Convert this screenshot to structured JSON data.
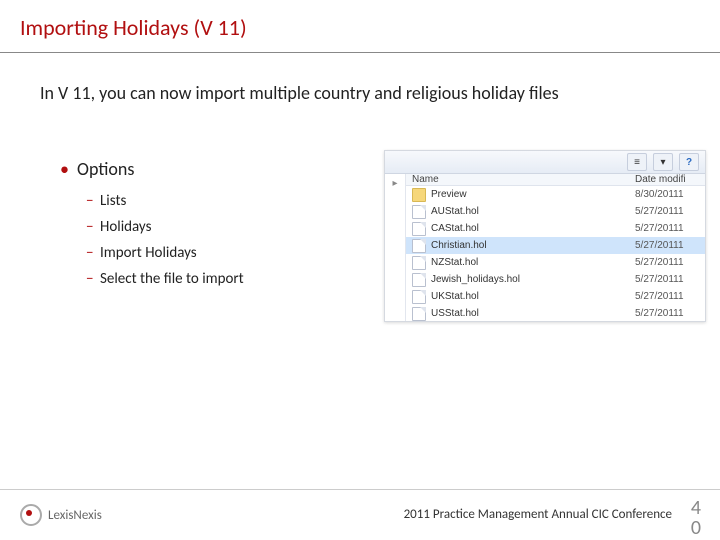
{
  "title": "Importing Holidays (V 11)",
  "intro": "In V 11, you can now import multiple country and religious holiday files",
  "bullet": "Options",
  "subitems": [
    "Lists",
    "Holidays",
    "Import Holidays",
    "Select the file to import"
  ],
  "file_browser": {
    "header_name": "Name",
    "header_date": "Date modifi",
    "rows": [
      {
        "name": "Preview",
        "date": "8/30/20111",
        "folder": true,
        "selected": false
      },
      {
        "name": "AUStat.hol",
        "date": "5/27/20111",
        "folder": false,
        "selected": false
      },
      {
        "name": "CAStat.hol",
        "date": "5/27/20111",
        "folder": false,
        "selected": false
      },
      {
        "name": "Christian.hol",
        "date": "5/27/20111",
        "folder": false,
        "selected": true
      },
      {
        "name": "NZStat.hol",
        "date": "5/27/20111",
        "folder": false,
        "selected": false
      },
      {
        "name": "Jewish_holidays.hol",
        "date": "5/27/20111",
        "folder": false,
        "selected": false
      },
      {
        "name": "UKStat.hol",
        "date": "5/27/20111",
        "folder": false,
        "selected": false
      },
      {
        "name": "USStat.hol",
        "date": "5/27/20111",
        "folder": false,
        "selected": false
      }
    ]
  },
  "footer_brand": "LexisNexis",
  "footer_conf": "2011 Practice Management Annual CIC Conference",
  "page_number_top": "4",
  "page_number_bottom": "0"
}
